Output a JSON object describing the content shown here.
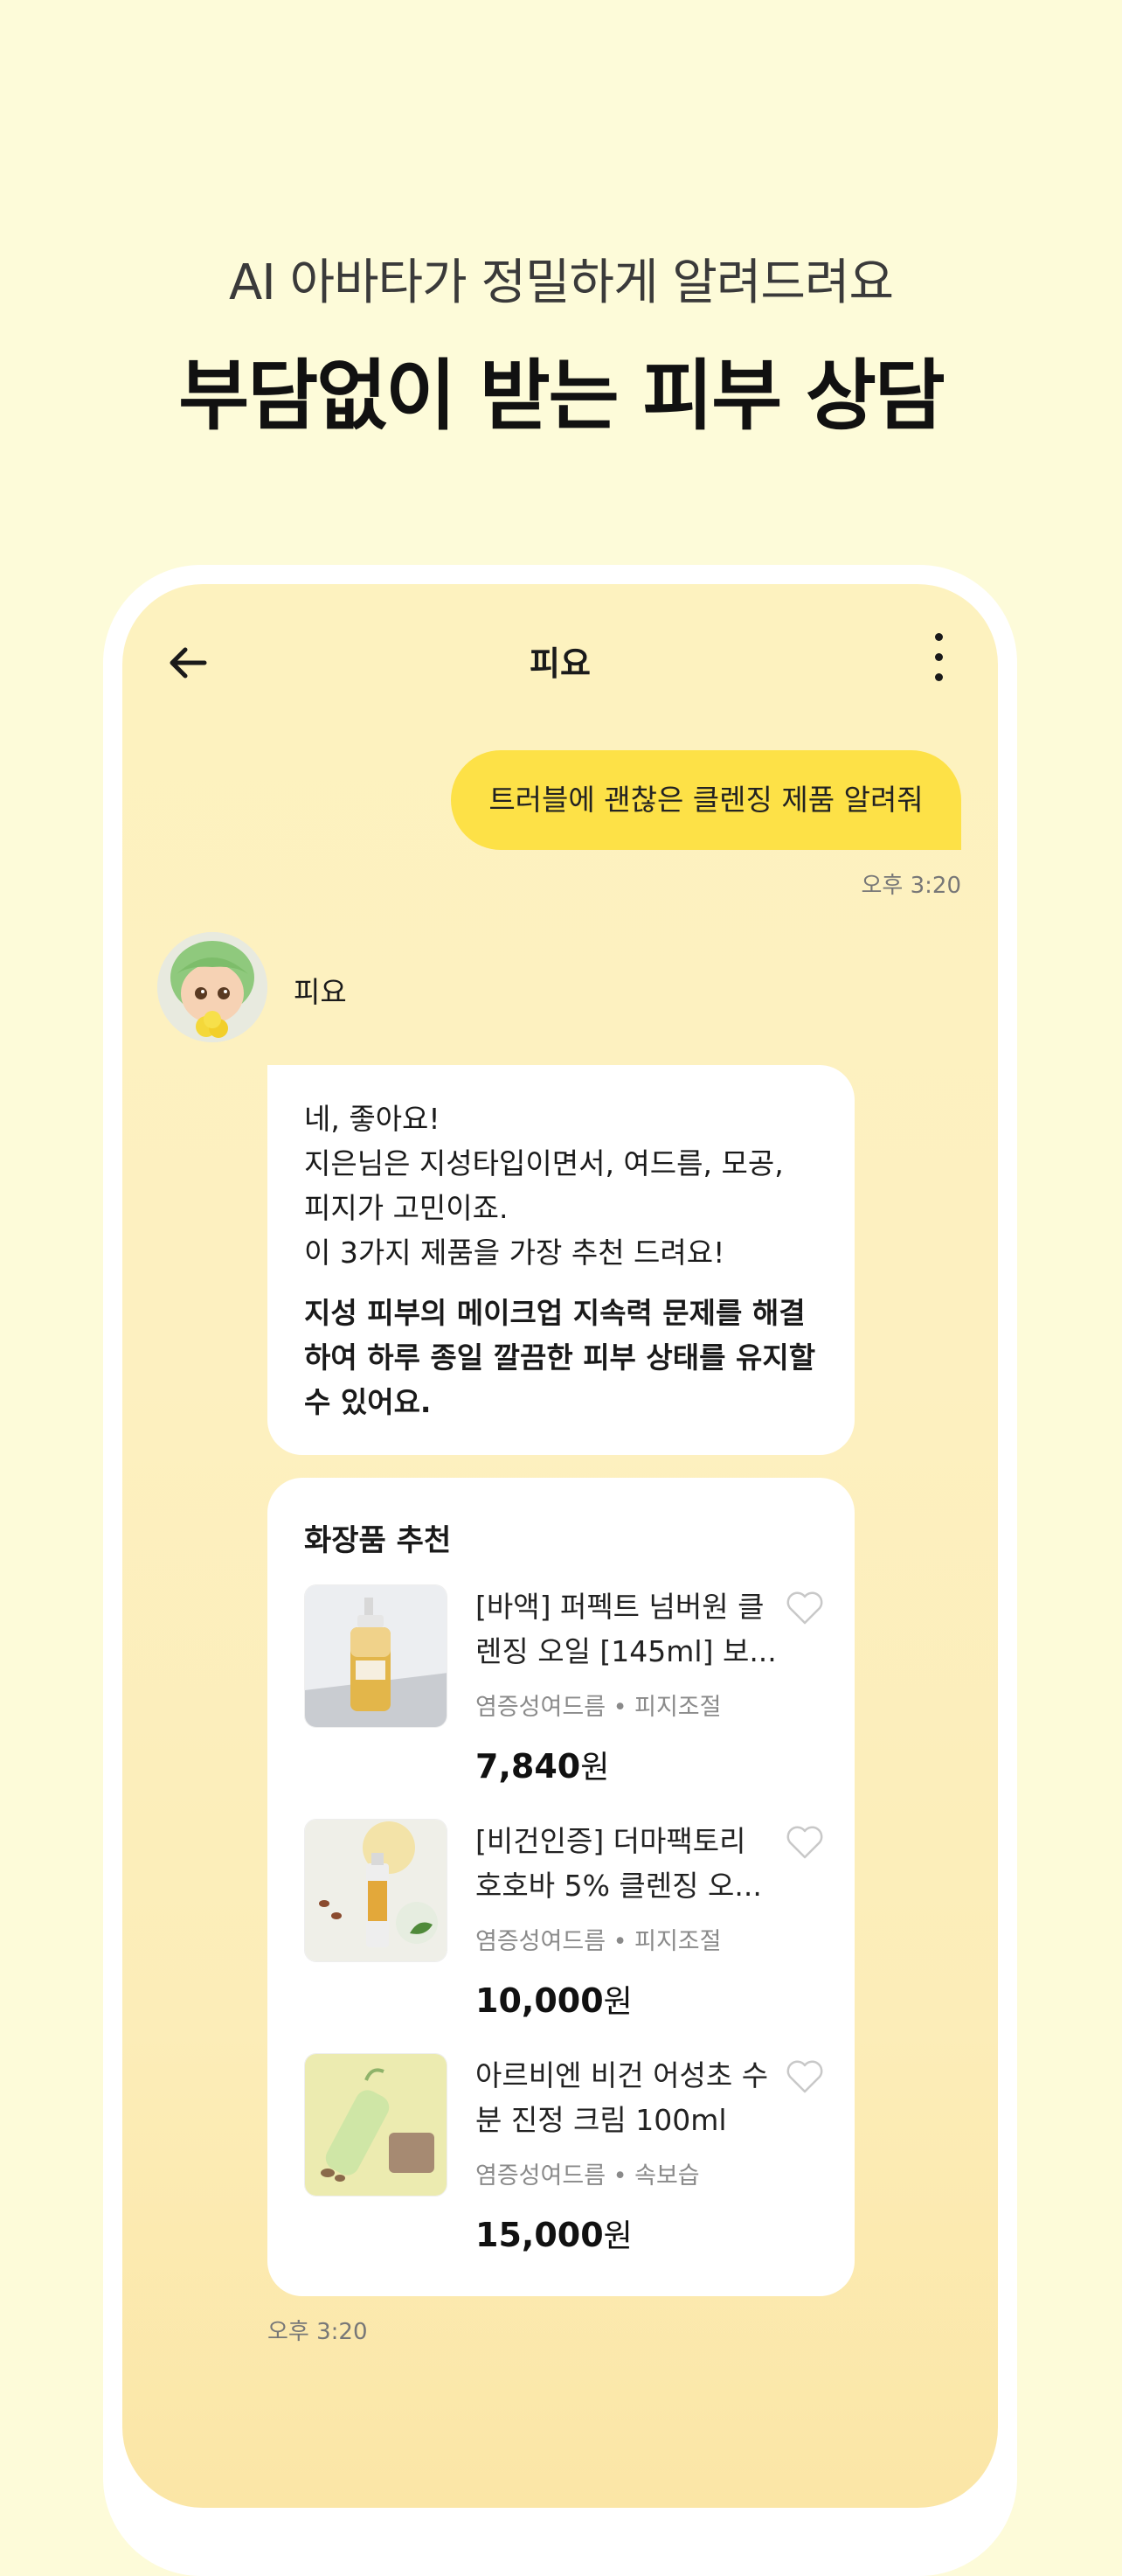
{
  "hero": {
    "subtitle": "AI 아바타가 정밀하게 알려드려요",
    "title": "부담없이 받는 피부 상담"
  },
  "navbar": {
    "title": "피요",
    "back_icon": "arrow-left-icon",
    "more_icon": "more-vertical-icon"
  },
  "chat": {
    "user_message": "트러블에 괜찮은 클렌징 제품 알려줘",
    "user_time": "오후 3:20",
    "bot_name": "피요",
    "bot_lines": [
      "네, 좋아요!",
      "지은님은 지성타입이면서, 여드름, 모공,",
      "피지가 고민이죠.",
      "이 3가지 제품을 가장 추천 드려요!"
    ],
    "bot_strong": "지성 피부의 메이크업 지속력 문제를 해결하여 하루 종일 깔끔한 피부 상태를 유지할 수 있어요.",
    "recommend": {
      "title": "화장품 추천",
      "products": [
        {
          "name": "[바액] 퍼펙트 넘버원 클렌징 오일 [145ml] 보...",
          "tags": "염증성여드름 • 피지조절",
          "price": "7,840",
          "unit": "원"
        },
        {
          "name": "[비건인증] 더마팩토리 호호바 5% 클렌징 오...",
          "tags": "염증성여드름 • 피지조절",
          "price": "10,000",
          "unit": "원"
        },
        {
          "name": "아르비엔 비건 어성초 수분 진정 크림 100ml",
          "tags": "염증성여드름 • 속보습",
          "price": "15,000",
          "unit": "원"
        }
      ]
    },
    "bot_time": "오후 3:20"
  },
  "colors": {
    "background": "#fdfbd9",
    "user_bubble": "#fde147",
    "accent_text": "#111111"
  }
}
